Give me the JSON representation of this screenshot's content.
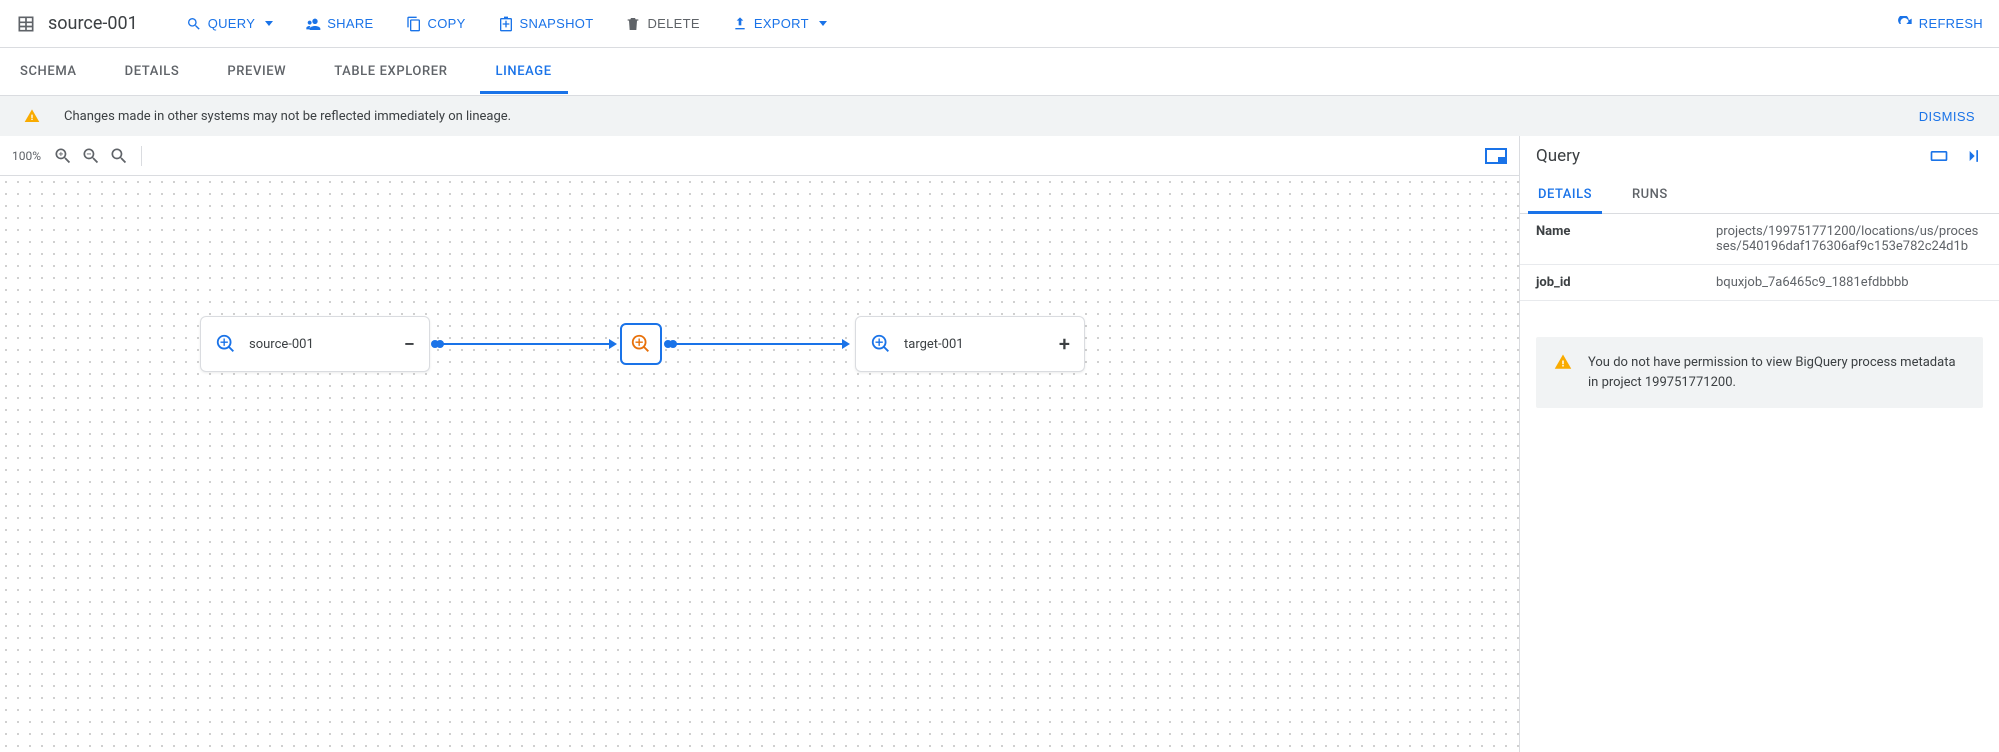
{
  "title": "source-001",
  "toolbar": {
    "query": "QUERY",
    "share": "SHARE",
    "copy": "COPY",
    "snapshot": "SNAPSHOT",
    "delete": "DELETE",
    "export": "EXPORT",
    "refresh": "REFRESH"
  },
  "tabs": {
    "schema": "SCHEMA",
    "details": "DETAILS",
    "preview": "PREVIEW",
    "table_explorer": "TABLE EXPLORER",
    "lineage": "LINEAGE"
  },
  "banner": {
    "message": "Changes made in other systems may not be reflected immediately on lineage.",
    "dismiss": "DISMISS"
  },
  "zoom": {
    "value": "100%"
  },
  "graph": {
    "source": {
      "label": "source-001",
      "toggle": "−"
    },
    "target": {
      "label": "target-001",
      "toggle": "+"
    }
  },
  "side": {
    "title": "Query",
    "tabs": {
      "details": "DETAILS",
      "runs": "RUNS"
    },
    "rows": [
      {
        "k": "Name",
        "v": "projects/199751771200/locations/us/processes/540196daf176306af9c153e782c24d1b"
      },
      {
        "k": "job_id",
        "v": "bquxjob_7a6465c9_1881efdbbbb"
      }
    ],
    "permission_msg": "You do not have permission to view BigQuery process metadata in project 199751771200."
  }
}
